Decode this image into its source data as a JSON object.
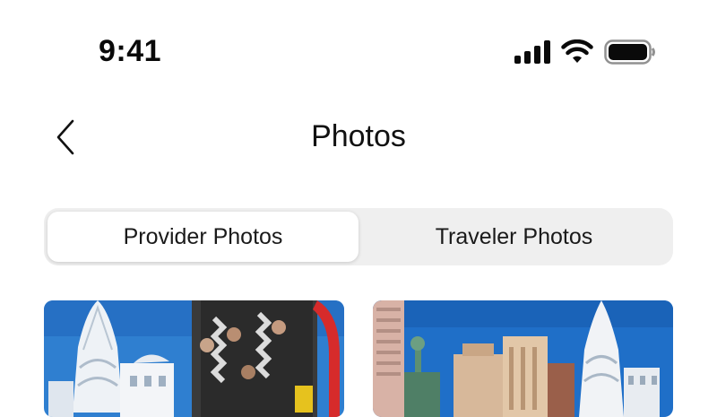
{
  "status_bar": {
    "time": "9:41",
    "icons": [
      "cellular-signal-icon",
      "wifi-icon",
      "battery-icon"
    ]
  },
  "nav": {
    "back_icon": "chevron-left-icon",
    "title": "Photos"
  },
  "tabs": [
    {
      "label": "Provider Photos",
      "selected": true
    },
    {
      "label": "Traveler Photos",
      "selected": false
    }
  ],
  "photos": [
    {
      "subject": "rollercoaster-riders-and-chrysler-tower"
    },
    {
      "subject": "new-york-new-york-skyline"
    }
  ],
  "colors": {
    "segment_bg": "#efefef",
    "segment_active": "#ffffff",
    "sky": "#1f6fc8"
  }
}
